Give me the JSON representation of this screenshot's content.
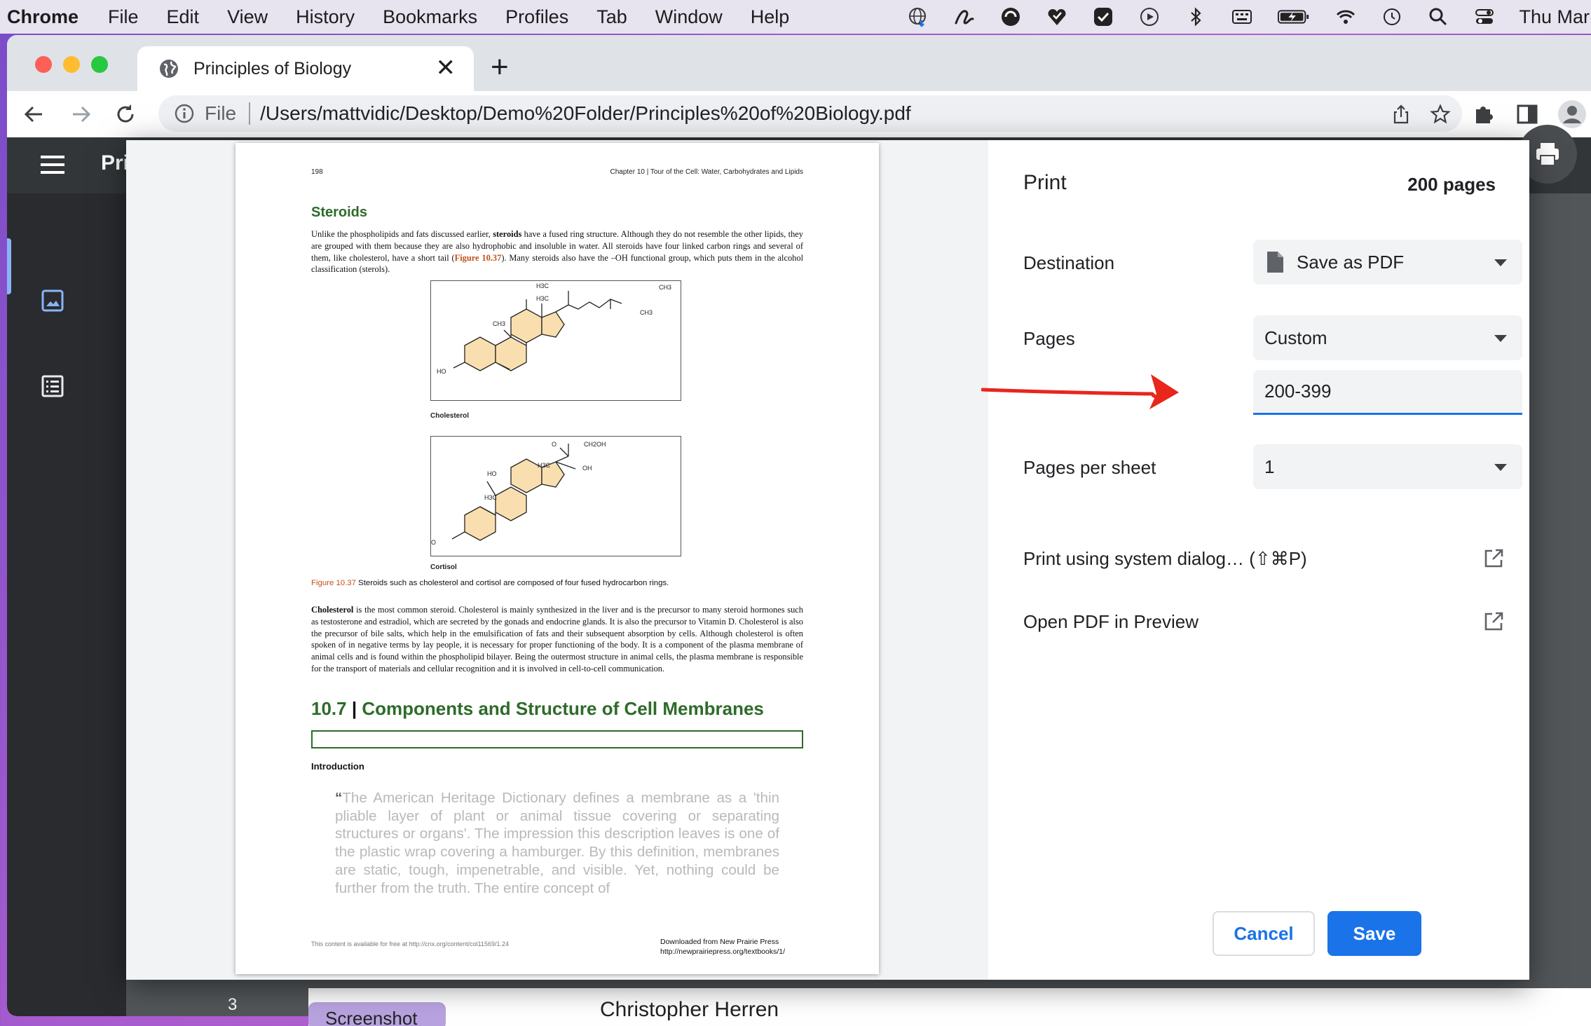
{
  "menubar": {
    "app": "Chrome",
    "items": [
      "File",
      "Edit",
      "View",
      "History",
      "Bookmarks",
      "Profiles",
      "Tab",
      "Window",
      "Help"
    ],
    "clock": "Thu Mar"
  },
  "browser": {
    "tab_title": "Principles of Biology",
    "url_scheme": "File",
    "url": "/Users/mattvidic/Desktop/Demo%20Folder/Principles%20of%20Biology.pdf"
  },
  "pdf_viewer": {
    "title": "Pri",
    "thumb_page_number": "3",
    "screenshot_label": "Screenshot",
    "behind_text": "Christopher Herren"
  },
  "preview_page": {
    "page_number": "198",
    "running_header": "Chapter 10 | Tour of the Cell: Water, Carbohydrates and Lipids",
    "section_heading": "Steroids",
    "para1_a": "Unlike the phospholipids and fats discussed earlier, ",
    "para1_b": "steroids",
    "para1_c": " have a fused ring structure. Although they do not resemble the other lipids, they are grouped with them because they are also hydrophobic and insoluble in water. All steroids have four linked carbon rings and several of them, like cholesterol, have a short tail (",
    "para1_ref": "Figure 10.37",
    "para1_d": "). Many steroids also have the –OH functional group, which puts them in the alcohol classification (sterols).",
    "fig1_caption": "Cholesterol",
    "fig2_caption": "Cortisol",
    "figure_label": "Figure 10.37",
    "figure_text": " Steroids such as cholesterol and cortisol are composed of four fused hydrocarbon rings.",
    "para2_a": "Cholesterol",
    "para2_b": " is the most common steroid. Cholesterol is mainly synthesized in the liver and is the precursor to many steroid hormones such as testosterone and estradiol, which are secreted by the gonads and endocrine glands. It is also the precursor to Vitamin D. Cholesterol is also the precursor of bile salts, which help in the emulsification of fats and their subsequent absorption by cells. Although cholesterol is often spoken of in negative terms by lay people, it is necessary for proper functioning of the body. It is a component of the plasma membrane of animal cells and is found within the phospholipid bilayer. Being the outermost structure in animal cells, the plasma membrane is responsible for the transport of materials and cellular recognition and it is involved in cell-to-cell communication.",
    "chapter_num": "10.7",
    "chapter_sep": " | ",
    "chapter_title": "Components and Structure of Cell Membranes",
    "intro_label": "Introduction",
    "quote_open": "“",
    "quote": "The American Heritage Dictionary defines a membrane as a 'thin pliable layer of plant or animal tissue covering or separating structures or organs'. The impression this description leaves is one of the plastic wrap covering a hamburger. By this definition, membranes are static, tough, impenetrable, and visible. Yet, nothing could be further from the truth. The entire concept of",
    "footer_left": "This content is available for free at http://cnx.org/content/col11569/1.24",
    "footer_right_1": "Downloaded from New Prairie Press",
    "footer_right_2": "http://newprairiepress.org/textbooks/1/",
    "chem": {
      "h3c_a": "H3C",
      "ch3_top": "CH3",
      "h3c_b": "H3C",
      "ch3_tail": "CH3",
      "ch3_ring": "CH3",
      "ho": "HO",
      "o_label": "O",
      "ch2oh": "CH2OH",
      "h3c_c": "H3C",
      "oh": "OH",
      "ho2": "HO",
      "h3c_d": "H3C",
      "o_bottom": "O"
    }
  },
  "print_settings": {
    "title": "Print",
    "page_count": "200 pages",
    "destination_label": "Destination",
    "destination_value": "Save as PDF",
    "pages_label": "Pages",
    "pages_value": "Custom",
    "custom_range": "200-399",
    "pages_per_sheet_label": "Pages per sheet",
    "pages_per_sheet_value": "1",
    "system_dialog": "Print using system dialog… (⇧⌘P)",
    "open_preview": "Open PDF in Preview",
    "cancel": "Cancel",
    "save": "Save"
  },
  "colors": {
    "accent": "#1a73e8",
    "annotation_arrow": "#e8261c",
    "heading_green": "#2e6b2a",
    "figure_orange": "#c0501b"
  }
}
